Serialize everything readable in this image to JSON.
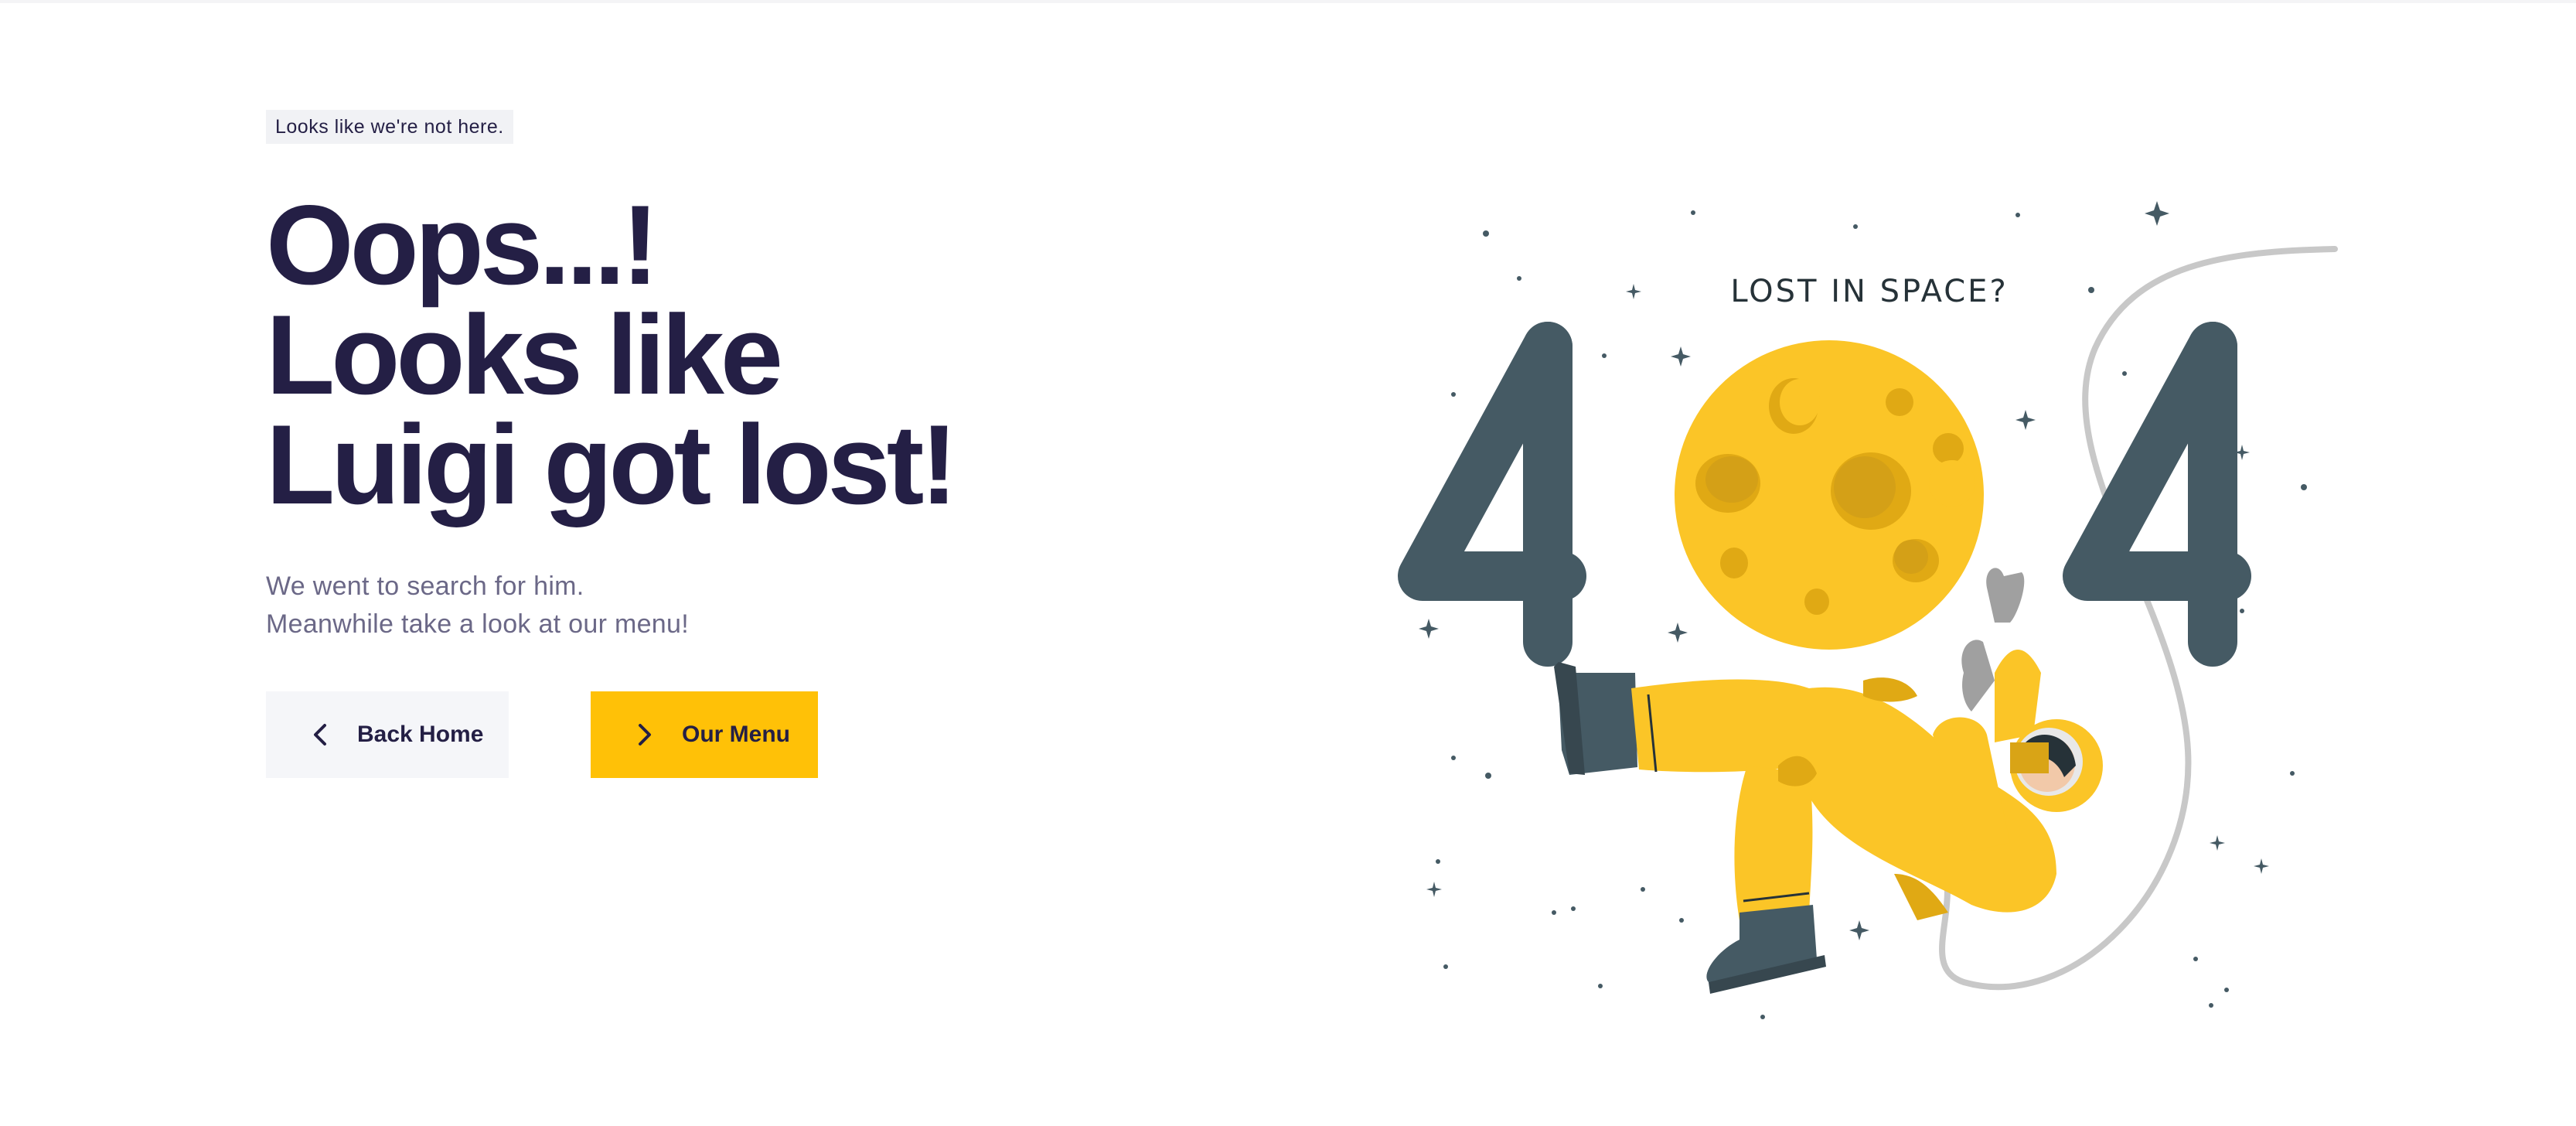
{
  "hero": {
    "eyebrow": "Looks like we're not here.",
    "headline_lines": [
      "Oops...!",
      "Looks like",
      "Luigi got lost!"
    ],
    "subtext_lines": [
      "We went to search for him.",
      "Meanwhile take a look at our menu!"
    ]
  },
  "buttons": {
    "back_home": "Back Home",
    "our_menu": "Our Menu"
  },
  "illustration": {
    "caption": "LOST IN SPACE?",
    "digits": [
      "4",
      "4"
    ],
    "icon": "astronaut-moon-404-illustration"
  },
  "colors": {
    "accent": "#ffc107",
    "heading": "#241f45",
    "body_text": "#6b6887",
    "digit": "#455a64",
    "moon": "#fbc527"
  }
}
